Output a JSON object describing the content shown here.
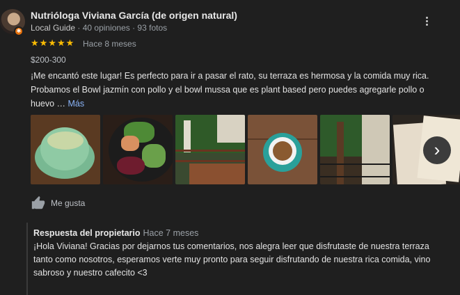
{
  "reviewer": {
    "name": "Nutrióloga Viviana García (de origen natural)",
    "badge": "Local Guide",
    "stats": " · 40 opiniones · 93 fotos"
  },
  "review": {
    "rating": 5,
    "stars": "★★★★★",
    "time_ago": "Hace 8 meses",
    "price": "$200-300",
    "text": "¡Me encantó este lugar! Es perfecto para ir a pasar el rato, su terraza es hermosa y la comida muy rica. Probamos el Bowl jazmín con pollo y el bowl mussa que es plant based pero puedes agregarle pollo o huevo … ",
    "more_label": "Más"
  },
  "actions": {
    "like_label": "Me gusta"
  },
  "owner_reply": {
    "title": "Respuesta del propietario",
    "time_ago": "Hace 7 meses",
    "text": "¡Hola Viviana! Gracias por dejarnos tus comentarios, nos alegra leer que disfrutaste de nuestra terraza tanto como nosotros, esperamos verte muy pronto para seguir disfrutando de nuestra rica comida, vino sabroso y nuestro cafecito <3"
  },
  "colors": {
    "background": "#1f1f1f",
    "star": "#fbbc04",
    "link": "#8ab4f8",
    "guide_badge": "#e8710a"
  },
  "icons": {
    "menu": "more-vert-icon",
    "next": "chevron-right-icon",
    "like": "thumb-up-icon"
  }
}
